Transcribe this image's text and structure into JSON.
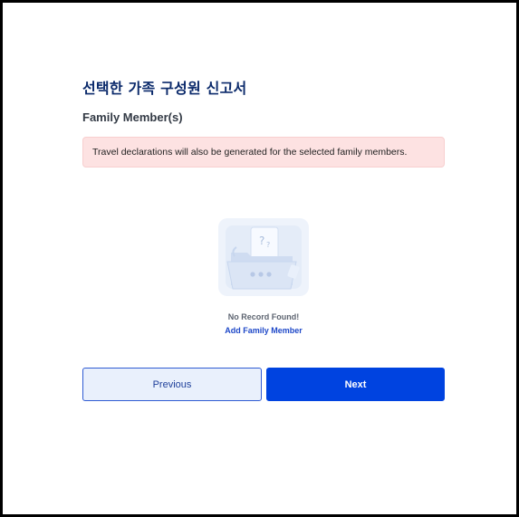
{
  "header": {
    "page_title": "선택한 가족 구성원 신고서",
    "section_title": "Family Member(s)"
  },
  "alert": {
    "message": "Travel declarations will also be generated for the selected family members."
  },
  "empty_state": {
    "illustration_icon": "empty-folder-icon",
    "message": "No Record Found!",
    "add_link": "Add Family Member"
  },
  "actions": {
    "previous_label": "Previous",
    "next_label": "Next"
  },
  "colors": {
    "title": "#0b2a6b",
    "alert_bg": "#fde2e2",
    "primary": "#0043e0",
    "link": "#1e48c8"
  }
}
